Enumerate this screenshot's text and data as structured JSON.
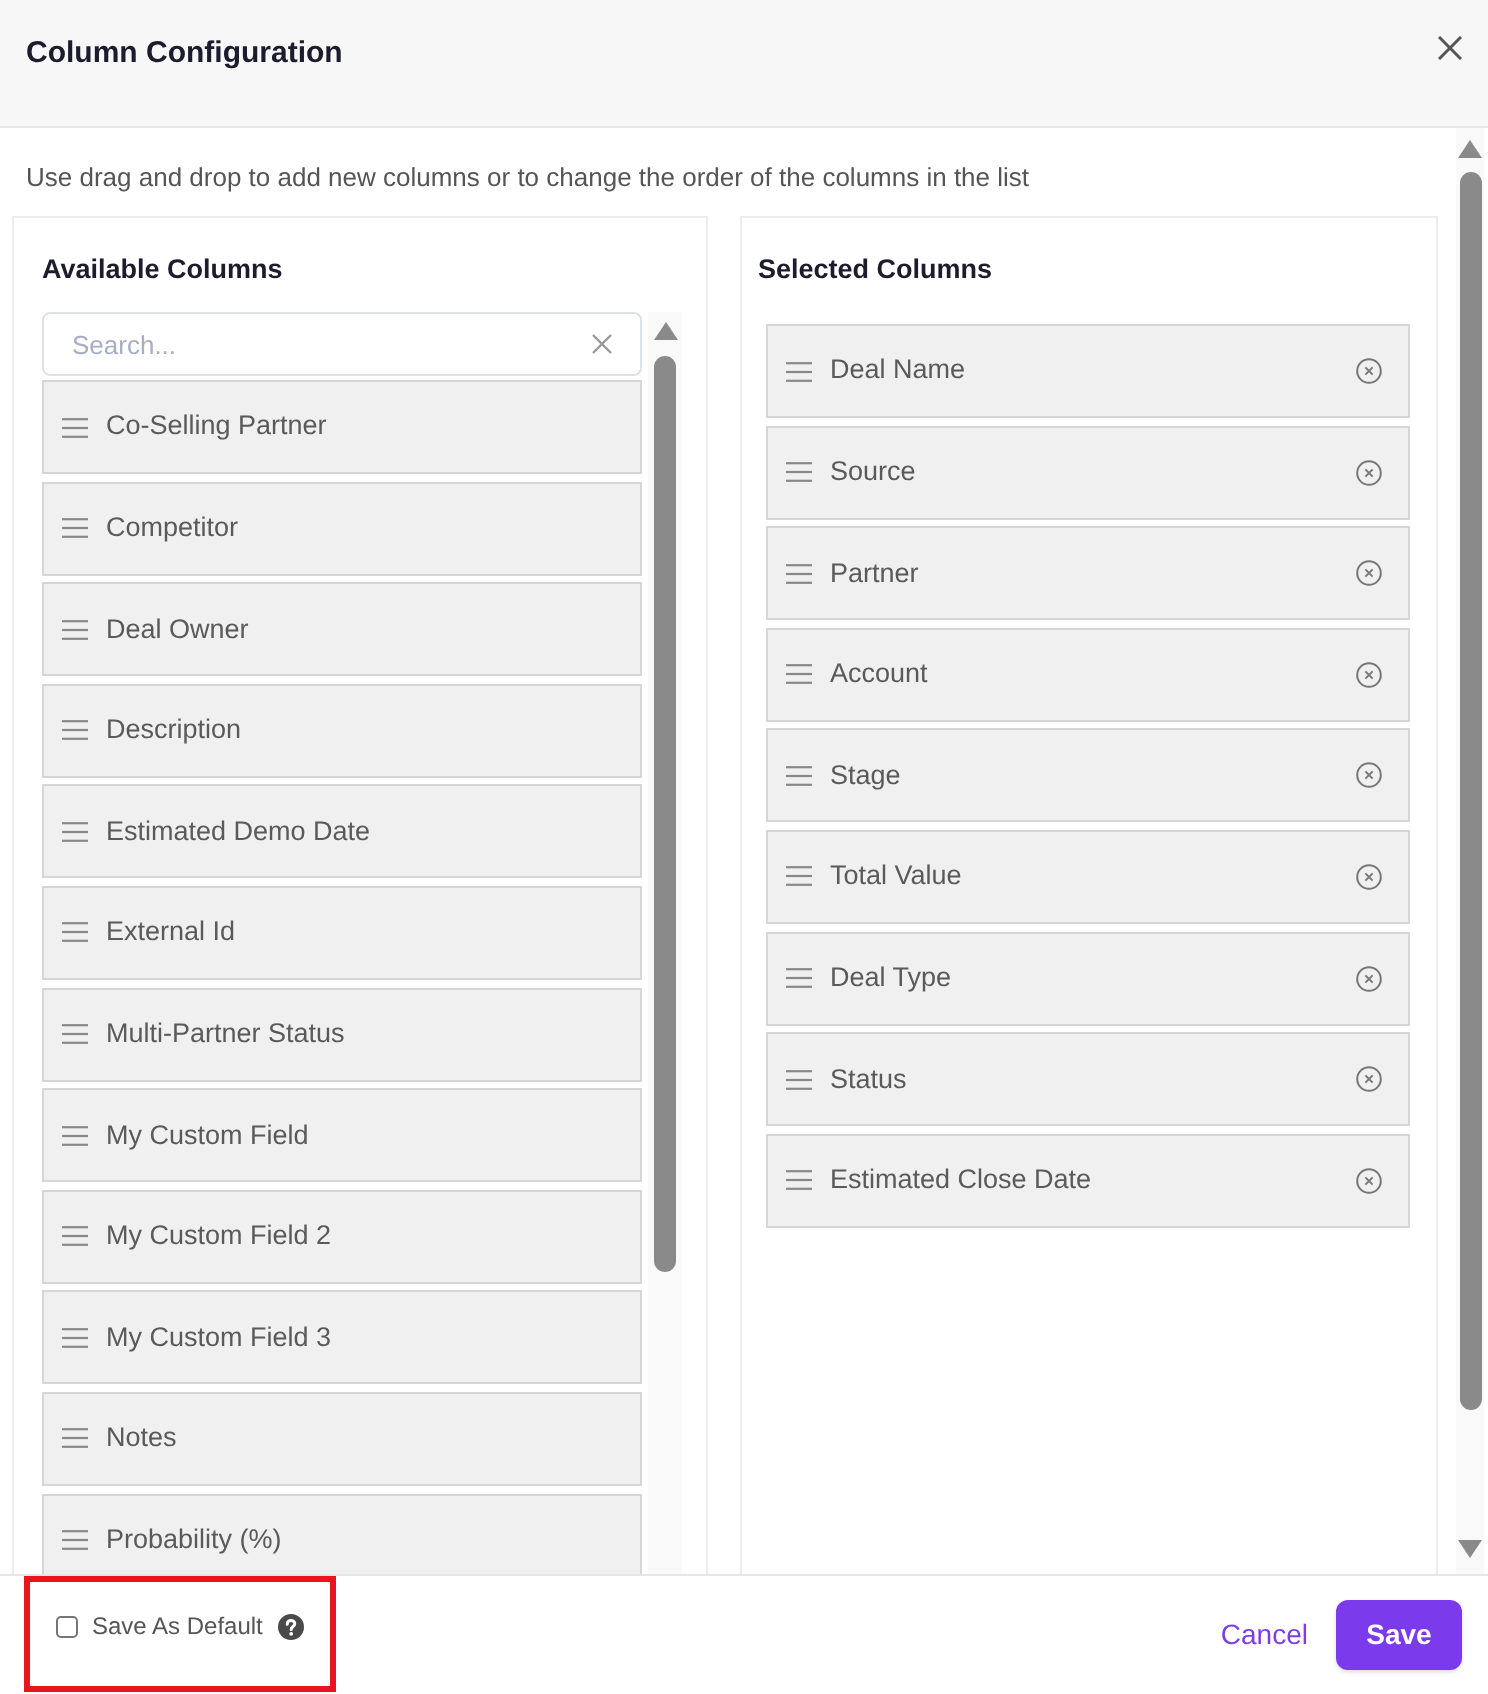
{
  "dialog": {
    "title": "Column Configuration",
    "instructions": "Use drag and drop to add new columns or to change the order of the columns in the list"
  },
  "available": {
    "heading": "Available Columns",
    "search": {
      "placeholder": "Search..."
    },
    "items": [
      "Co-Selling Partner",
      "Competitor",
      "Deal Owner",
      "Description",
      "Estimated Demo Date",
      "External Id",
      "Multi-Partner Status",
      "My Custom Field",
      "My Custom Field 2",
      "My Custom Field 3",
      "Notes",
      "Probability (%)"
    ]
  },
  "selected": {
    "heading": "Selected Columns",
    "items": [
      "Deal Name",
      "Source",
      "Partner",
      "Account",
      "Stage",
      "Total Value",
      "Deal Type",
      "Status",
      "Estimated Close Date"
    ]
  },
  "footer": {
    "save_default": {
      "label": "Save As Default",
      "checked": false,
      "highlighted": true
    },
    "buttons": [
      {
        "label": "Cancel",
        "kind": "link"
      },
      {
        "label": "Save",
        "kind": "primary"
      }
    ]
  }
}
